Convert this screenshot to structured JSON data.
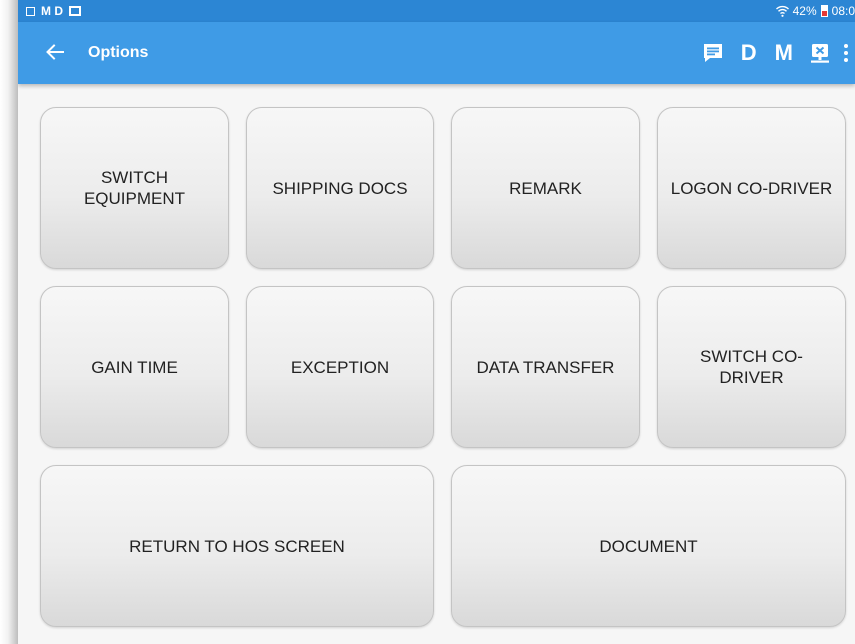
{
  "status_bar": {
    "left_text": "M D",
    "right_text": "42%",
    "time": "08:0"
  },
  "app_bar": {
    "title": "Options",
    "back_icon": "arrow-left-icon",
    "actions": {
      "message_icon": "message-icon",
      "d_label": "D",
      "m_label": "M",
      "sync_icon": "sync-x-icon",
      "more_icon": "more-vert-icon"
    }
  },
  "colors": {
    "status_bar": "#2c86d4",
    "app_bar": "#3f9be6",
    "background": "#f6f6f6",
    "button_text": "#222222"
  },
  "options": [
    {
      "id": "switch-equipment",
      "label": "SWITCH\nEQUIPMENT"
    },
    {
      "id": "shipping-docs",
      "label": "SHIPPING DOCS"
    },
    {
      "id": "remark",
      "label": "REMARK"
    },
    {
      "id": "logon-co-driver",
      "label": "LOGON CO-DRIVER"
    },
    {
      "id": "gain-time",
      "label": "GAIN TIME"
    },
    {
      "id": "exception",
      "label": "EXCEPTION"
    },
    {
      "id": "data-transfer",
      "label": "DATA TRANSFER"
    },
    {
      "id": "switch-co-driver",
      "label": "SWITCH CO-\nDRIVER"
    },
    {
      "id": "return-to-hos-screen",
      "label": "RETURN TO HOS SCREEN"
    },
    {
      "id": "document",
      "label": "DOCUMENT"
    }
  ]
}
